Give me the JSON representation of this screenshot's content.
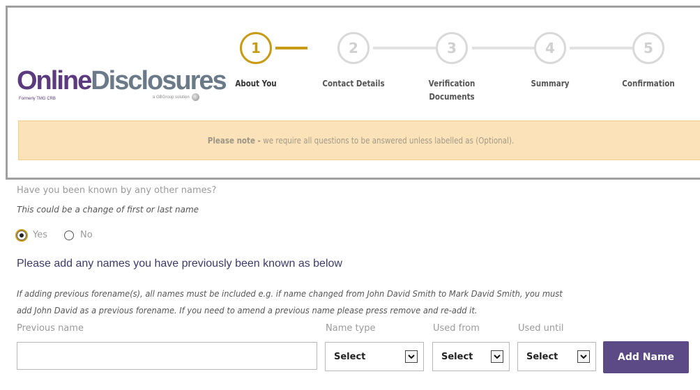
{
  "brand": {
    "logo_part1": "Online",
    "logo_part2": "Disclosures",
    "formerly": "Formerly TMG CRB",
    "group": "a GBGroup solution"
  },
  "stepper": {
    "steps": [
      {
        "number": "1",
        "label": "About You",
        "active": true
      },
      {
        "number": "2",
        "label": "Contact Details",
        "active": false
      },
      {
        "number": "3",
        "label": "Verification Documents",
        "active": false
      },
      {
        "number": "4",
        "label": "Summary",
        "active": false
      },
      {
        "number": "5",
        "label": "Confirmation",
        "active": false
      }
    ]
  },
  "notice": {
    "strong": "Please note -",
    "text": "we require all questions to be answered unless labelled as (Optional)."
  },
  "question": {
    "label": "Have you been known by any other names?",
    "hint": "This could be a change of first or last name",
    "options": [
      "Yes",
      "No"
    ],
    "selected": "Yes"
  },
  "previous_names": {
    "title": "Please add any names you have previously been known as below",
    "instructions_line1": "If adding previous forename(s), all names must be included e.g. if name changed from John David Smith to Mark David Smith, you must",
    "instructions_line2": "add John David as a previous forename. If you need to amend a previous name please press remove and re-add it.",
    "previous_name_label": "Previous name",
    "previous_name_value": "",
    "name_type_label": "Name type",
    "used_from_label": "Used from",
    "used_until_label": "Used until",
    "name_type_value": "Select",
    "used_from_value": "Select",
    "used_until_value": "Select",
    "add_button": "Add Name"
  },
  "colors": {
    "accent_gold": "#c99a14",
    "brand_purple": "#5b3a7f",
    "button_purple": "#5b4a86",
    "notice_bg": "#fbe2b8"
  }
}
